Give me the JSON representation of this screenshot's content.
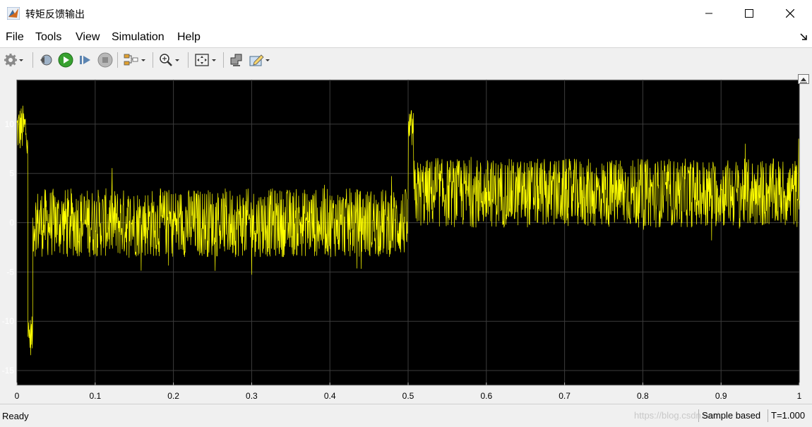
{
  "window": {
    "title": "转矩反馈输出",
    "minimize_icon": "minimize-icon",
    "maximize_icon": "maximize-icon",
    "close_icon": "close-icon"
  },
  "menu": {
    "items": [
      "File",
      "Tools",
      "View",
      "Simulation",
      "Help"
    ],
    "undock_icon": "undock-arrow-icon"
  },
  "toolbar": {
    "icons": [
      "gear-icon",
      "dropdown-icon",
      "step-back-icon",
      "run-icon",
      "step-forward-icon",
      "stop-icon",
      "signal-selector-icon",
      "dropdown-icon",
      "zoom-in-icon",
      "dropdown-icon",
      "autoscale-icon",
      "dropdown-icon",
      "cursor-measure-icon",
      "highlight-icon",
      "dropdown-icon"
    ]
  },
  "status": {
    "left": "Ready",
    "sample": "Sample based",
    "time": "T=1.000",
    "watermark": "https://blog.csdn.net/..."
  },
  "colors": {
    "background": "#000000",
    "grid": "#3c3c3c",
    "signal": "#ffff00",
    "axis_text": "#ffffff"
  },
  "chart_data": {
    "type": "line",
    "title": "",
    "xlabel": "",
    "ylabel": "",
    "xlim": [
      0,
      1
    ],
    "ylim": [
      -16.5,
      14.5
    ],
    "xticks": [
      "0",
      "0.1",
      "0.2",
      "0.3",
      "0.4",
      "0.5",
      "0.6",
      "0.7",
      "0.8",
      "0.9",
      "1"
    ],
    "yticks": [
      "10",
      "5",
      "0",
      "-5",
      "-10",
      "-15"
    ],
    "ytick_values": [
      10,
      5,
      0,
      -5,
      -10,
      -15
    ],
    "grid": true,
    "series": [
      {
        "description_segments": [
          {
            "x": [
              0.0,
              0.014
            ],
            "level": 9.5,
            "band": 2.5
          },
          {
            "x": [
              0.014,
              0.02
            ],
            "level": -11.5,
            "band": 2.0
          },
          {
            "x": [
              0.02,
              0.5
            ],
            "level": 0.0,
            "band": 3.5
          },
          {
            "x": [
              0.5,
              0.507
            ],
            "level": 9.5,
            "band": 2.0
          },
          {
            "x": [
              0.507,
              1.0
            ],
            "level": 3.0,
            "band": 3.5
          }
        ]
      }
    ]
  }
}
